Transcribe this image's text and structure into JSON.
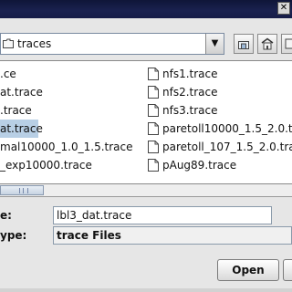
{
  "title_bar": {
    "close_glyph": "✕"
  },
  "look_in": {
    "value": "traces"
  },
  "toolbar": {
    "buttons": [
      "home-icon",
      "new-folder-icon",
      "list-view-icon"
    ]
  },
  "files_col1": [
    {
      "label": ".ce",
      "selected": false
    },
    {
      "label": "at.trace",
      "selected": false
    },
    {
      "label": ".trace",
      "selected": false
    },
    {
      "label": "at.trace",
      "selected": true
    },
    {
      "label": "mal10000_1.0_1.5.trace",
      "selected": false
    },
    {
      "label": "_exp10000.trace",
      "selected": false
    }
  ],
  "files_col2": [
    {
      "label": "nfs1.trace"
    },
    {
      "label": "nfs2.trace"
    },
    {
      "label": "nfs3.trace"
    },
    {
      "label": "paretoll10000_1.5_2.0.trace"
    },
    {
      "label": "paretoll_107_1.5_2.0.trace"
    },
    {
      "label": "pAug89.trace"
    }
  ],
  "file_name": {
    "label": "e:",
    "value": "lbl3_dat.trace"
  },
  "file_type": {
    "label": "ype:",
    "value": "trace Files"
  },
  "actions": {
    "open": "Open"
  }
}
